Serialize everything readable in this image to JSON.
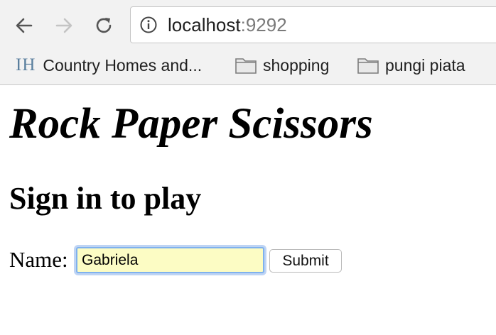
{
  "browser": {
    "url_host": "localhost",
    "url_port": ":9292",
    "bookmarks": [
      {
        "label": "Country Homes and...",
        "icon": "ih-logo",
        "logo_text": "IH"
      },
      {
        "label": "shopping",
        "icon": "folder-icon"
      },
      {
        "label": "pungi piata",
        "icon": "folder-icon"
      }
    ],
    "icons": {
      "back": "back-arrow-icon",
      "forward": "forward-arrow-icon",
      "reload": "reload-icon",
      "site_info": "info-icon"
    }
  },
  "page": {
    "title": "Rock Paper Scissors",
    "subtitle": "Sign in to play",
    "form": {
      "name_label": "Name:",
      "name_value": "Gabriela",
      "submit_label": "Submit"
    }
  }
}
